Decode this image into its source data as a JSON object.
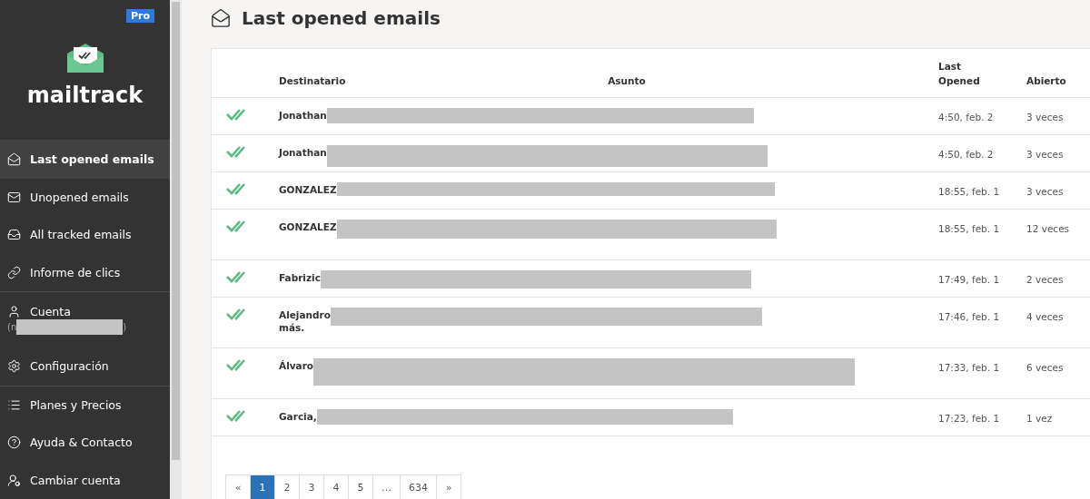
{
  "sidebar": {
    "badge": "Pro",
    "logo": "mailtrack",
    "items": [
      {
        "kind": "nav",
        "label": "Last opened emails",
        "selected": true
      },
      {
        "kind": "nav",
        "label": "Unopened emails",
        "selected": false
      },
      {
        "kind": "nav",
        "label": "All tracked emails",
        "selected": false
      },
      {
        "kind": "nav",
        "label": "Informe de clics",
        "selected": false
      },
      {
        "kind": "account",
        "label": "Cuenta",
        "prefix": "(n",
        "suffix": ")",
        "selected": false
      },
      {
        "kind": "nav",
        "label": "Configuración",
        "selected": false
      },
      {
        "kind": "nav",
        "label": "Planes y Precios",
        "selected": false
      },
      {
        "kind": "nav",
        "label": "Ayuda & Contacto",
        "selected": false
      },
      {
        "kind": "nav",
        "label": "Cambiar cuenta",
        "selected": false
      }
    ]
  },
  "page": {
    "title": "Last opened emails"
  },
  "table": {
    "columns": [
      "Destinatario",
      "Asunto",
      "Last Opened",
      "Abierto"
    ],
    "rows": [
      {
        "recipient": "Jonathan",
        "last_opened": "4:50, feb. 2",
        "opened": "3 veces"
      },
      {
        "recipient": "Jonathan",
        "last_opened": "4:50, feb. 2",
        "opened": "3 veces"
      },
      {
        "recipient": "GONZALEZ",
        "last_opened": "18:55, feb. 1",
        "opened": "3 veces"
      },
      {
        "recipient": "GONZALEZ",
        "last_opened": "18:55, feb. 1",
        "opened": "12 veces"
      },
      {
        "recipient": "Fabrizic",
        "last_opened": "17:49, feb. 1",
        "opened": "2 veces"
      },
      {
        "recipient": "Alejandro",
        "recipient_line2": "más.",
        "last_opened": "17:46, feb. 1",
        "opened": "4 veces"
      },
      {
        "recipient": "Álvaro",
        "last_opened": "17:33, feb. 1",
        "opened": "6 veces"
      },
      {
        "recipient": "Garcia,",
        "last_opened": "17:23, feb. 1",
        "opened": "1 vez"
      }
    ]
  },
  "pagination": [
    {
      "label": "«",
      "selected": false
    },
    {
      "label": "1",
      "selected": true
    },
    {
      "label": "2",
      "selected": false
    },
    {
      "label": "3",
      "selected": false
    },
    {
      "label": "4",
      "selected": false
    },
    {
      "label": "5",
      "selected": false
    },
    {
      "label": "…",
      "selected": false
    },
    {
      "label": "634",
      "selected": false
    },
    {
      "label": "»",
      "selected": false
    }
  ]
}
